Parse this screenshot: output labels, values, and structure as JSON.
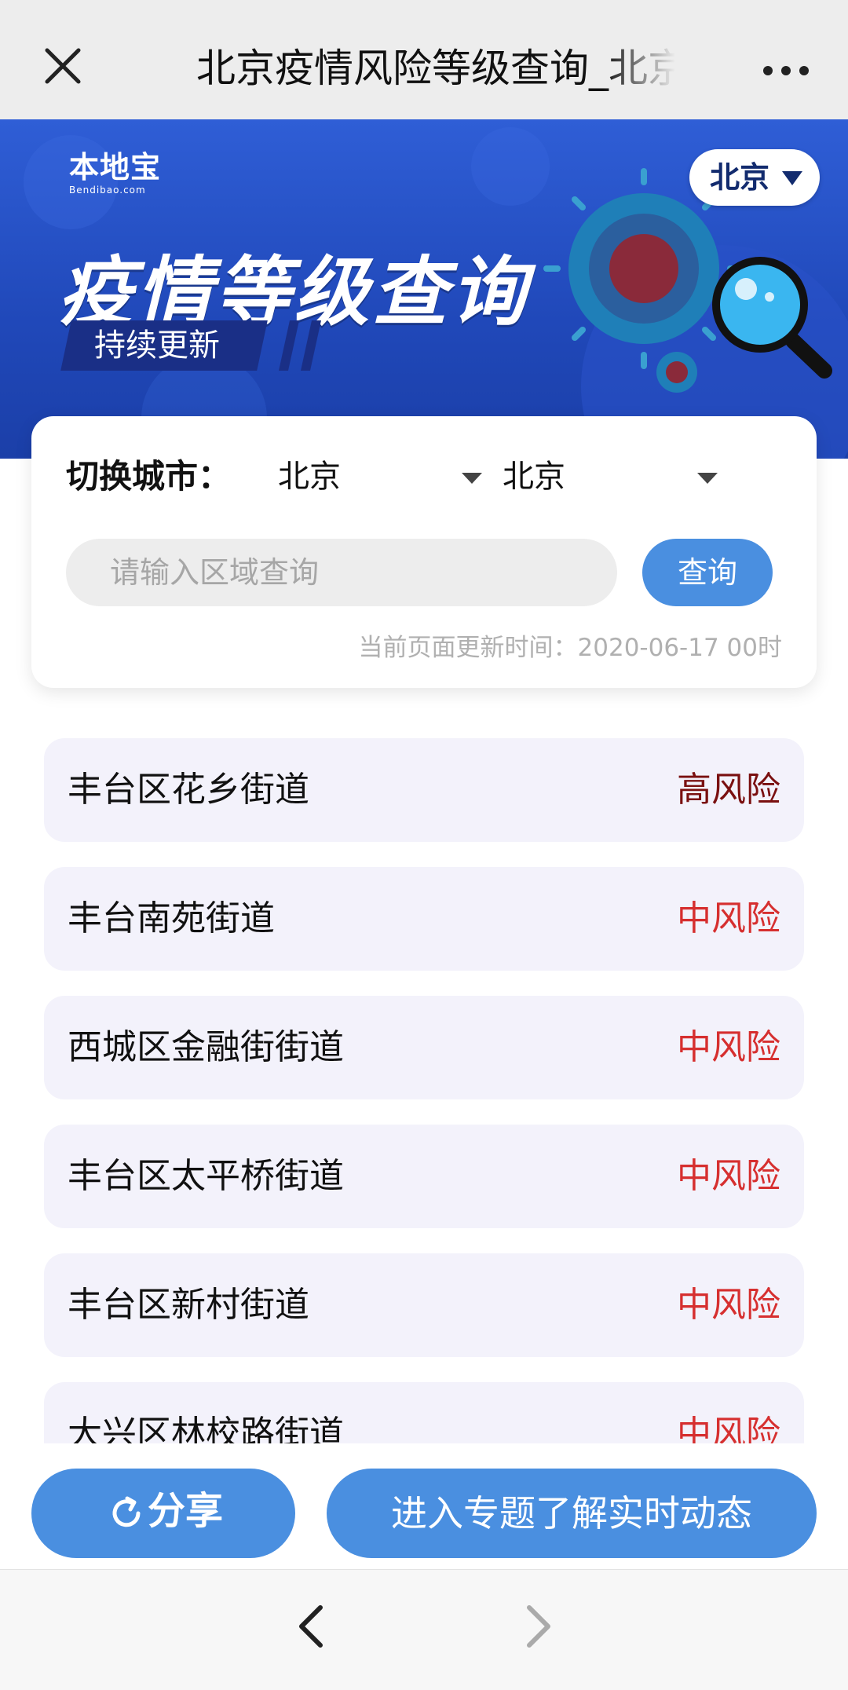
{
  "header": {
    "title": "北京疫情风险等级查询_北京"
  },
  "banner": {
    "logo_text": "本地宝",
    "logo_sub": "Bendibao.com",
    "title": "疫情等级查询",
    "tag": "持续更新",
    "city": "北京",
    "colors": {
      "background": "#2048b9",
      "tag": "#1a2f86"
    }
  },
  "selector": {
    "label": "切换城市：",
    "province": "北京",
    "city": "北京",
    "search_placeholder": "请输入区域查询",
    "search_value": "",
    "query_label": "查询",
    "update_time": "当前页面更新时间：2020-06-17 00时"
  },
  "risk_list": [
    {
      "name": "丰台区花乡街道",
      "risk": "高风险",
      "color": "#7a1010"
    },
    {
      "name": "丰台南苑街道",
      "risk": "中风险",
      "color": "#d62f2f"
    },
    {
      "name": "西城区金融街街道",
      "risk": "中风险",
      "color": "#d62f2f"
    },
    {
      "name": "丰台区太平桥街道",
      "risk": "中风险",
      "color": "#d62f2f"
    },
    {
      "name": "丰台区新村街道",
      "risk": "中风险",
      "color": "#d62f2f"
    },
    {
      "name": "大兴区林校路街道",
      "risk": "中风险",
      "color": "#d62f2f"
    }
  ],
  "actions": {
    "share": "分享",
    "topic": "进入专题了解实时动态",
    "accent": "#4a8fe0"
  },
  "nav": {
    "back_icon": "chevron-left-icon",
    "forward_icon": "chevron-right-icon"
  }
}
